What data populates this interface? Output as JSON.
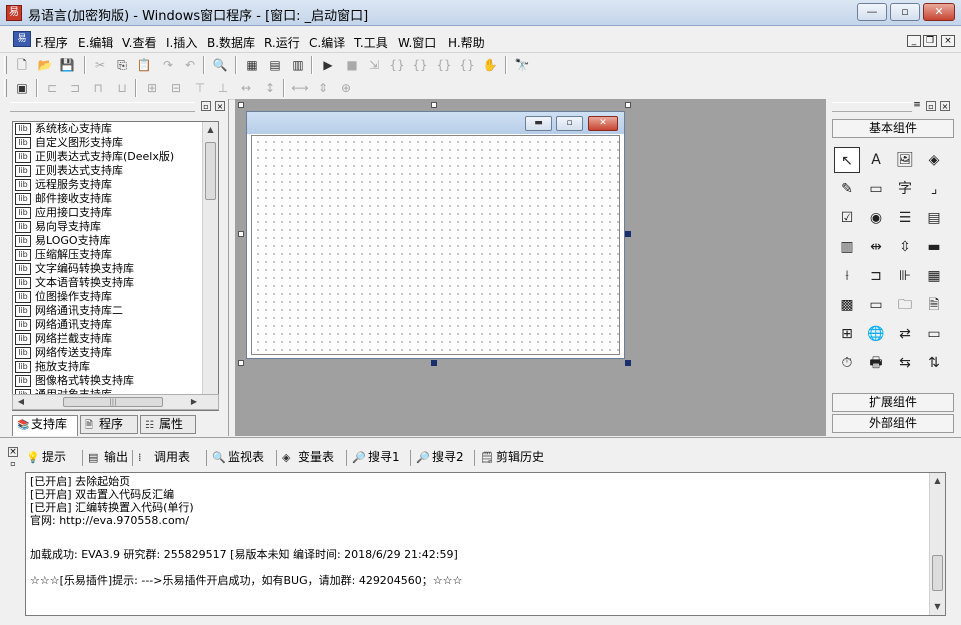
{
  "window": {
    "title": "易语言(加密狗版) - Windows窗口程序 - [窗口: _启动窗口]",
    "minimize": "—",
    "maximize": "▫",
    "close": "✕"
  },
  "menu": {
    "items": [
      "F.程序",
      "E.编辑",
      "V.查看",
      "I.插入",
      "B.数据库",
      "R.运行",
      "C.编译",
      "T.工具",
      "W.窗口",
      "H.帮助"
    ],
    "mdi_min": "_",
    "mdi_restore": "❐",
    "mdi_close": "×"
  },
  "toolbar1": [
    {
      "icon": "new-file-icon",
      "glyph": "🗋",
      "enabled": true
    },
    {
      "icon": "open-folder-icon",
      "glyph": "📂",
      "enabled": true
    },
    {
      "icon": "save-icon",
      "glyph": "💾",
      "enabled": true
    },
    {
      "icon": "cut-icon",
      "glyph": "✂",
      "enabled": false
    },
    {
      "icon": "copy-icon",
      "glyph": "⎘",
      "enabled": true
    },
    {
      "icon": "paste-icon",
      "glyph": "📋",
      "enabled": false
    },
    {
      "icon": "redo-icon",
      "glyph": "↷",
      "enabled": false
    },
    {
      "icon": "undo-icon",
      "glyph": "↶",
      "enabled": false
    },
    {
      "icon": "find-icon",
      "glyph": "🔍",
      "enabled": true
    },
    {
      "icon": "layout1-icon",
      "glyph": "▦",
      "enabled": true
    },
    {
      "icon": "layout2-icon",
      "glyph": "▤",
      "enabled": true
    },
    {
      "icon": "layout3-icon",
      "glyph": "▥",
      "enabled": true
    },
    {
      "icon": "run-icon",
      "glyph": "▶",
      "enabled": true
    },
    {
      "icon": "stop-icon",
      "glyph": "■",
      "enabled": false
    },
    {
      "icon": "step-icon",
      "glyph": "⇲",
      "enabled": false
    },
    {
      "icon": "step-into-icon",
      "glyph": "{}",
      "enabled": false
    },
    {
      "icon": "step-over-icon",
      "glyph": "{}",
      "enabled": false
    },
    {
      "icon": "step-out-icon",
      "glyph": "{}",
      "enabled": false
    },
    {
      "icon": "breakpoint-icon",
      "glyph": "{}",
      "enabled": false
    },
    {
      "icon": "hand-icon",
      "glyph": "✋",
      "enabled": false
    },
    {
      "icon": "binoculars-icon",
      "glyph": "🔭",
      "enabled": true
    }
  ],
  "toolbar2": [
    {
      "icon": "grid-toggle-icon",
      "glyph": "▣",
      "enabled": true
    },
    {
      "icon": "align-left-icon",
      "glyph": "⊏",
      "enabled": false
    },
    {
      "icon": "align-center-icon",
      "glyph": "⊐",
      "enabled": false
    },
    {
      "icon": "align-right-icon",
      "glyph": "⊓",
      "enabled": false
    },
    {
      "icon": "align-top-icon",
      "glyph": "⊔",
      "enabled": false
    },
    {
      "icon": "center-h-icon",
      "glyph": "⊞",
      "enabled": false
    },
    {
      "icon": "center-v-icon",
      "glyph": "⊟",
      "enabled": false
    },
    {
      "icon": "align-bottom-icon",
      "glyph": "⊤",
      "enabled": false
    },
    {
      "icon": "same-width-icon",
      "glyph": "⊥",
      "enabled": false
    },
    {
      "icon": "space-h-icon",
      "glyph": "↔",
      "enabled": false
    },
    {
      "icon": "space-v-icon",
      "glyph": "↕",
      "enabled": false
    },
    {
      "icon": "same-size-h-icon",
      "glyph": "⟷",
      "enabled": false
    },
    {
      "icon": "same-size-v-icon",
      "glyph": "⇕",
      "enabled": false
    },
    {
      "icon": "center-form-icon",
      "glyph": "⊕",
      "enabled": false
    }
  ],
  "libraries": [
    "系统核心支持库",
    "自定义图形支持库",
    "正则表达式支持库(Deelx版)",
    "正则表达式支持库",
    "远程服务支持库",
    "邮件接收支持库",
    "应用接口支持库",
    "易向导支持库",
    "易LOGO支持库",
    "压缩解压支持库",
    "文字编码转换支持库",
    "文本语音转换支持库",
    "位图操作支持库",
    "网络通讯支持库二",
    "网络通讯支持库",
    "网络拦截支持库",
    "网络传送支持库",
    "拖放支持库",
    "图像格式转换支持库",
    "通用对象支持库"
  ],
  "left_tabs": [
    {
      "label": "支持库",
      "icon": "library-icon",
      "glyph": "📚"
    },
    {
      "label": "程序",
      "icon": "program-icon",
      "glyph": "🗎"
    },
    {
      "label": "属性",
      "icon": "property-icon",
      "glyph": "☷"
    }
  ],
  "components": {
    "basic": "基本组件",
    "extended": "扩展组件",
    "external": "外部组件",
    "items": [
      {
        "icon": "pointer-icon",
        "glyph": "↖"
      },
      {
        "icon": "label-icon",
        "glyph": "A"
      },
      {
        "icon": "picture-icon",
        "glyph": "🖼"
      },
      {
        "icon": "shape-icon",
        "glyph": "◈"
      },
      {
        "icon": "editbox-icon",
        "glyph": "✎"
      },
      {
        "icon": "imagebox-icon",
        "glyph": "▭"
      },
      {
        "icon": "text-icon",
        "glyph": "字"
      },
      {
        "icon": "line-icon",
        "glyph": "⌟"
      },
      {
        "icon": "checkbox-icon",
        "glyph": "☑"
      },
      {
        "icon": "radio-icon",
        "glyph": "◉"
      },
      {
        "icon": "listbox-icon",
        "glyph": "☰"
      },
      {
        "icon": "combobox-icon",
        "glyph": "▤"
      },
      {
        "icon": "listview-icon",
        "glyph": "▥"
      },
      {
        "icon": "hscroll-icon",
        "glyph": "⇹"
      },
      {
        "icon": "vscroll-icon",
        "glyph": "⇳"
      },
      {
        "icon": "progress-icon",
        "glyph": "▬"
      },
      {
        "icon": "slider-icon",
        "glyph": "⟊"
      },
      {
        "icon": "tabs-icon",
        "glyph": "⊐"
      },
      {
        "icon": "splitter-icon",
        "glyph": "⊪"
      },
      {
        "icon": "calendar-icon",
        "glyph": "▦"
      },
      {
        "icon": "table-icon",
        "glyph": "▩"
      },
      {
        "icon": "button-icon",
        "glyph": "▭"
      },
      {
        "icon": "folder-icon",
        "glyph": "🗀"
      },
      {
        "icon": "document-icon",
        "glyph": "🗎"
      },
      {
        "icon": "tree-icon",
        "glyph": "⊞"
      },
      {
        "icon": "web-icon",
        "glyph": "🌐"
      },
      {
        "icon": "transfer-icon",
        "glyph": "⇄"
      },
      {
        "icon": "statusbar-icon",
        "glyph": "▭"
      },
      {
        "icon": "timer-icon",
        "glyph": "⏱"
      },
      {
        "icon": "printer-icon",
        "glyph": "🖶"
      },
      {
        "icon": "client-icon",
        "glyph": "⇆"
      },
      {
        "icon": "server-icon",
        "glyph": "⇅"
      }
    ]
  },
  "bottom_tabs": [
    {
      "label": "提示",
      "icon": "tip-icon",
      "glyph": "💡"
    },
    {
      "label": "输出",
      "icon": "output-icon",
      "glyph": "▤"
    },
    {
      "label": "调用表",
      "icon": "call-table-icon",
      "glyph": "⁞"
    },
    {
      "label": "监视表",
      "icon": "watch-icon",
      "glyph": "🔍"
    },
    {
      "label": "变量表",
      "icon": "variable-icon",
      "glyph": "◈"
    },
    {
      "label": "搜寻1",
      "icon": "search1-icon",
      "glyph": "🔎"
    },
    {
      "label": "搜寻2",
      "icon": "search2-icon",
      "glyph": "🔎"
    },
    {
      "label": "剪辑历史",
      "icon": "clip-history-icon",
      "glyph": "🗒"
    }
  ],
  "output_lines": [
    "[已开启] 去除起始页",
    "[已开启] 双击置入代码反汇编",
    "[已开启] 汇编转换置入代码(单行)",
    "官网: http://eva.970558.com/",
    "",
    "加载成功: EVA3.9 研究群: 255829517 [易版本未知 编译时间: 2018/6/29 21:42:59]",
    "",
    "☆☆☆[乐易插件]提示: --->乐易插件开启成功，如有BUG，请加群: 429204560；☆☆☆"
  ]
}
